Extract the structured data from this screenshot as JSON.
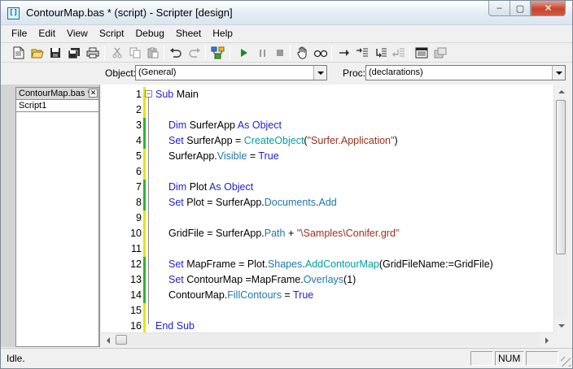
{
  "window": {
    "title": "ContourMap.bas * (script) - Scripter [design]",
    "controls": {
      "minimize": "–",
      "maximize": "▢",
      "close": "✕"
    }
  },
  "menu": [
    "File",
    "Edit",
    "View",
    "Script",
    "Debug",
    "Sheet",
    "Help"
  ],
  "toolbar": {
    "icons": [
      "new-icon",
      "open-icon",
      "save-icon",
      "save-all-icon",
      "print-icon",
      "cut-icon",
      "copy-icon",
      "paste-icon",
      "undo-icon",
      "redo-icon",
      "references-icon",
      "run-icon",
      "pause-icon",
      "stop-icon",
      "hand-icon",
      "quick-watch-icon",
      "step-into-icon",
      "step-over-icon",
      "step-out-icon",
      "toggle-breakpoint-icon",
      "dialog-editor-icon",
      "object-browser-icon"
    ]
  },
  "objbar": {
    "object_label": "Object:",
    "object_value": "(General)",
    "proc_label": "Proc:",
    "proc_value": "(declarations)"
  },
  "left_panel": {
    "tab_label": "ContourMap.bas *",
    "tab_close": "✕",
    "scripts": [
      "Script1"
    ]
  },
  "editor": {
    "lines": [
      {
        "n": "1",
        "code": "Sub Main"
      },
      {
        "n": "2",
        "code": ""
      },
      {
        "n": "3",
        "code": "Dim SurferApp As Object"
      },
      {
        "n": "4",
        "code": "Set SurferApp = CreateObject(\"Surfer.Application\")"
      },
      {
        "n": "5",
        "code": "SurferApp.Visible = True"
      },
      {
        "n": "6",
        "code": ""
      },
      {
        "n": "7",
        "code": "Dim Plot As Object"
      },
      {
        "n": "8",
        "code": "Set Plot = SurferApp.Documents.Add"
      },
      {
        "n": "9",
        "code": ""
      },
      {
        "n": "10",
        "code": "GridFile = SurferApp.Path + \"\\Samples\\Conifer.grd\""
      },
      {
        "n": "11",
        "code": ""
      },
      {
        "n": "12",
        "code": "Set MapFrame = Plot.Shapes.AddContourMap(GridFileName:=GridFile)"
      },
      {
        "n": "13",
        "code": "Set ContourMap =MapFrame.Overlays(1)"
      },
      {
        "n": "14",
        "code": "ContourMap.FillContours = True"
      },
      {
        "n": "15",
        "code": ""
      },
      {
        "n": "16",
        "code": "End Sub"
      }
    ],
    "fold_sign": "⊟",
    "colors": {
      "keyword": "#1f1fcf",
      "property": "#1e77a6",
      "function": "#00a0a0",
      "string": "#9c2f1c",
      "changed": "#2db52d",
      "saved": "#e6e600"
    }
  },
  "status": {
    "text": "Idle.",
    "num": "NUM"
  }
}
